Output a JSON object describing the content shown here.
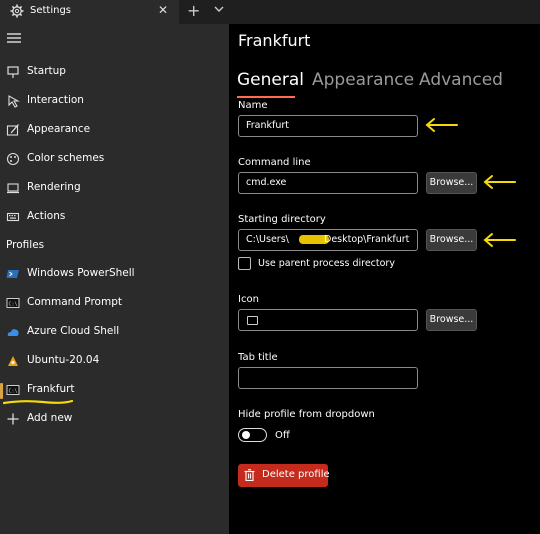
{
  "window": {
    "tab_title": "Settings",
    "close_glyph": "✕",
    "new_tab_glyph": "+"
  },
  "sidebar": {
    "items": [
      {
        "label": "Startup",
        "icon": "startup-icon"
      },
      {
        "label": "Interaction",
        "icon": "interaction-icon"
      },
      {
        "label": "Appearance",
        "icon": "appearance-icon"
      },
      {
        "label": "Color schemes",
        "icon": "color-schemes-icon"
      },
      {
        "label": "Rendering",
        "icon": "rendering-icon"
      },
      {
        "label": "Actions",
        "icon": "actions-icon"
      }
    ],
    "profiles_header": "Profiles",
    "profiles": [
      {
        "label": "Windows PowerShell",
        "icon": "powershell-icon"
      },
      {
        "label": "Command Prompt",
        "icon": "command-prompt-icon"
      },
      {
        "label": "Azure Cloud Shell",
        "icon": "azure-icon"
      },
      {
        "label": "Ubuntu-20.04",
        "icon": "ubuntu-icon"
      },
      {
        "label": "Frankfurt",
        "icon": "terminal-icon",
        "selected": true
      },
      {
        "label": "Add new",
        "icon": "plus-icon"
      }
    ]
  },
  "main": {
    "title": "Frankfurt",
    "tabs": [
      {
        "label": "General",
        "active": true
      },
      {
        "label": "Appearance",
        "active": false
      },
      {
        "label": "Advanced",
        "active": false
      }
    ],
    "name": {
      "label": "Name",
      "value": "Frankfurt"
    },
    "command_line": {
      "label": "Command line",
      "value": "cmd.exe",
      "browse": "Browse..."
    },
    "starting_directory": {
      "label": "Starting directory",
      "value_prefix": "C:\\Users\\",
      "value_suffix": "Desktop\\Frankfurt",
      "browse": "Browse..."
    },
    "use_parent": {
      "label": "Use parent process directory",
      "checked": false
    },
    "icon": {
      "label": "Icon",
      "browse": "Browse..."
    },
    "tab_title": {
      "label": "Tab title",
      "value": ""
    },
    "hide_profile": {
      "label": "Hide profile from dropdown",
      "state": "Off"
    },
    "delete_button": "Delete profile"
  },
  "colors": {
    "accent_underline": "#ff6b55",
    "delete": "#c42b1c",
    "annotation_yellow": "#f5d90a",
    "sidebar_bg": "#2b2b2b"
  }
}
